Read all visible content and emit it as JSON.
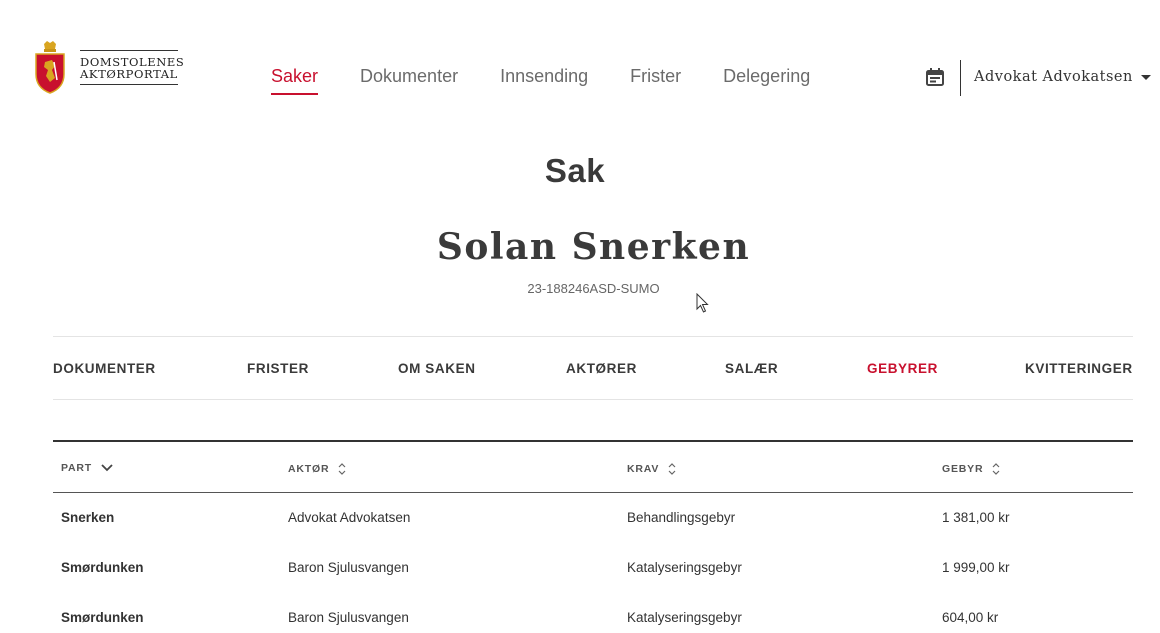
{
  "brand": {
    "line1": "DOMSTOLENES",
    "line2": "AKTØRPORTAL"
  },
  "nav": {
    "items": [
      {
        "label": "Saker",
        "active": true
      },
      {
        "label": "Dokumenter",
        "active": false
      },
      {
        "label": "Innsending",
        "active": false
      },
      {
        "label": "Frister",
        "active": false
      },
      {
        "label": "Delegering",
        "active": false
      }
    ]
  },
  "user": {
    "name": "Advokat Advokatsen"
  },
  "page": {
    "title": "Sak",
    "case_name": "Solan Snerken",
    "case_id": "23-188246ASD-SUMO"
  },
  "tabs": [
    {
      "label": "DOKUMENTER",
      "active": false
    },
    {
      "label": "FRISTER",
      "active": false
    },
    {
      "label": "OM SAKEN",
      "active": false
    },
    {
      "label": "AKTØRER",
      "active": false
    },
    {
      "label": "SALÆR",
      "active": false
    },
    {
      "label": "GEBYRER",
      "active": true
    },
    {
      "label": "KVITTERINGER",
      "active": false
    }
  ],
  "table": {
    "headers": [
      {
        "label": "PART",
        "sort": "desc"
      },
      {
        "label": "AKTØR",
        "sort": "none"
      },
      {
        "label": "KRAV",
        "sort": "none"
      },
      {
        "label": "GEBYR",
        "sort": "none"
      }
    ],
    "rows": [
      [
        "Snerken",
        "Advokat Advokatsen",
        "Behandlingsgebyr",
        "1 381,00 kr"
      ],
      [
        "Smørdunken",
        "Baron Sjulusvangen",
        "Katalyseringsgebyr",
        "1 999,00 kr"
      ],
      [
        "Smørdunken",
        "Baron Sjulusvangen",
        "Katalyseringsgebyr",
        "604,00 kr"
      ]
    ]
  },
  "colors": {
    "accent": "#c8102e",
    "text": "#333333",
    "muted": "#6b6b6b"
  }
}
